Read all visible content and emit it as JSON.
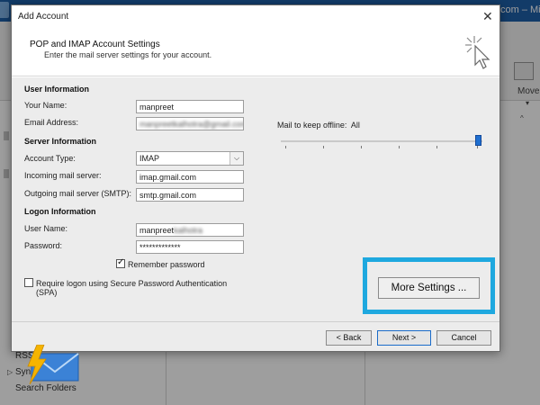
{
  "background": {
    "window_title": "com – Mic",
    "ribbon_move_label": "Move",
    "folders": [
      "RSS",
      "Sync",
      "Search Folders"
    ]
  },
  "dialog": {
    "title": "Add Account",
    "close_glyph": "✕",
    "header": {
      "heading": "POP and IMAP Account Settings",
      "subtitle": "Enter the mail server settings for your account."
    },
    "user_information": {
      "section": "User Information",
      "name_label": "Your Name:",
      "name_value": "manpreet",
      "email_label": "Email Address:",
      "email_value": "manpreetkalhotra@gmail.com"
    },
    "server_information": {
      "section": "Server Information",
      "account_type_label": "Account Type:",
      "account_type_value": "IMAP",
      "incoming_label": "Incoming mail server:",
      "incoming_value": "imap.gmail.com",
      "outgoing_label": "Outgoing mail server (SMTP):",
      "outgoing_value": "smtp.gmail.com"
    },
    "logon_information": {
      "section": "Logon Information",
      "username_label": "User Name:",
      "username_value": "manpreet",
      "username_blurred_suffix": "kalhotra",
      "password_label": "Password:",
      "password_value": "*************",
      "remember_label": "Remember password",
      "remember_checked": true,
      "spa_label_line1": "Require logon using Secure Password Authentication",
      "spa_label_line2": "(SPA)",
      "spa_checked": false
    },
    "offline": {
      "label": "Mail to keep offline:",
      "value": "All",
      "slider_level": 1.0
    },
    "more_settings_label": "More Settings ...",
    "highlight_color": "#1ea8df",
    "buttons": {
      "back": "< Back",
      "next": "Next >",
      "cancel": "Cancel"
    }
  }
}
